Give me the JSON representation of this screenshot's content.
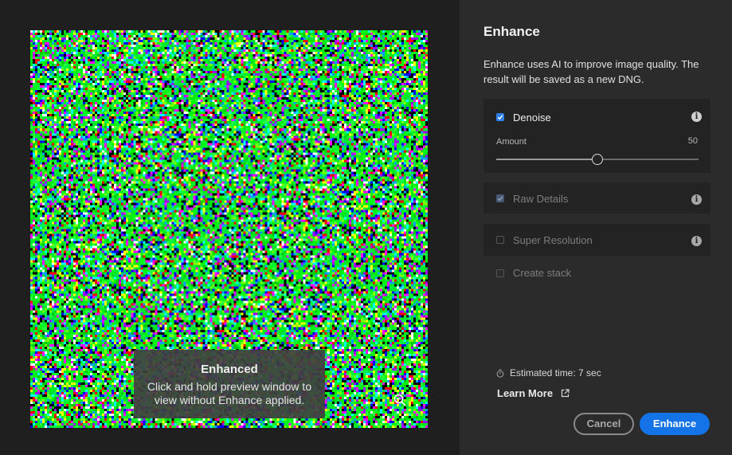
{
  "dialog": {
    "title": "Enhance",
    "description": "Enhance uses AI to improve image quality. The result will be saved as a new DNG."
  },
  "preview": {
    "overlay_title": "Enhanced",
    "overlay_hint": "Click and hold preview window to view without Enhance applied.",
    "image_description_icon": "noise-pattern-preview",
    "zoom_icon": "zoom-out-icon"
  },
  "options": {
    "denoise": {
      "label": "Denoise",
      "checked": true,
      "enabled": true,
      "amount_label": "Amount",
      "amount_value": "50",
      "amount_min": 0,
      "amount_max": 100,
      "amount_fraction": 0.5
    },
    "raw_details": {
      "label": "Raw Details",
      "checked": true,
      "enabled": false
    },
    "super_resolution": {
      "label": "Super Resolution",
      "checked": false,
      "enabled": false
    },
    "create_stack": {
      "label": "Create stack",
      "checked": false,
      "enabled": false
    }
  },
  "footer": {
    "estimate": "Estimated time: 7 sec",
    "learn_more": "Learn More",
    "cancel_label": "Cancel",
    "enhance_label": "Enhance"
  },
  "colors": {
    "accent": "#1473e6",
    "panel_bg": "#2b2b2b",
    "card_bg": "#232323",
    "preview_bg": "#1f1f1f"
  }
}
